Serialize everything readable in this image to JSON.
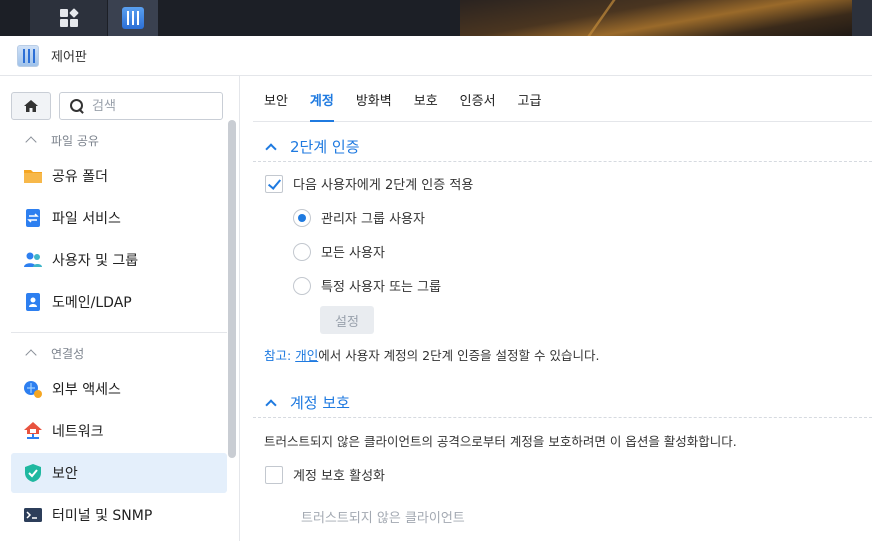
{
  "window": {
    "title": "제어판"
  },
  "sidebar": {
    "search_placeholder": "검색",
    "sections": [
      {
        "label": "파일 공유"
      },
      {
        "label": "연결성"
      }
    ],
    "items": [
      {
        "label": "공유 폴더",
        "icon": "shared-folder-icon"
      },
      {
        "label": "파일 서비스",
        "icon": "file-services-icon"
      },
      {
        "label": "사용자 및 그룹",
        "icon": "users-groups-icon"
      },
      {
        "label": "도메인/LDAP",
        "icon": "domain-ldap-icon"
      },
      {
        "label": "외부 액세스",
        "icon": "external-access-icon"
      },
      {
        "label": "네트워크",
        "icon": "network-icon"
      },
      {
        "label": "보안",
        "icon": "security-shield-icon",
        "active": true
      },
      {
        "label": "터미널 및 SNMP",
        "icon": "terminal-icon"
      }
    ]
  },
  "tabs": [
    {
      "label": "보안"
    },
    {
      "label": "계정",
      "active": true
    },
    {
      "label": "방화벽"
    },
    {
      "label": "보호"
    },
    {
      "label": "인증서"
    },
    {
      "label": "고급"
    }
  ],
  "two_factor": {
    "title": "2단계 인증",
    "enforce_label": "다음 사용자에게 2단계 인증 적용",
    "enforce_checked": true,
    "options": [
      {
        "label": "관리자 그룹 사용자",
        "selected": true
      },
      {
        "label": "모든 사용자",
        "selected": false
      },
      {
        "label": "특정 사용자 또는 그룹",
        "selected": false
      }
    ],
    "settings_button": "설정",
    "note_label": "참고:",
    "note_link": "개인",
    "note_text": "에서 사용자 계정의 2단계 인증을 설정할 수 있습니다."
  },
  "account_protection": {
    "title": "계정 보호",
    "description": "트러스트되지 않은 클라이언트의 공격으로부터 계정을 보호하려면 이 옵션을 활성화합니다.",
    "enable_label": "계정 보호 활성화",
    "enable_checked": false,
    "untrusted_label": "트러스트되지 않은 클라이언트"
  },
  "colors": {
    "accent": "#1f7ae0",
    "active_bg": "#e4effb"
  }
}
